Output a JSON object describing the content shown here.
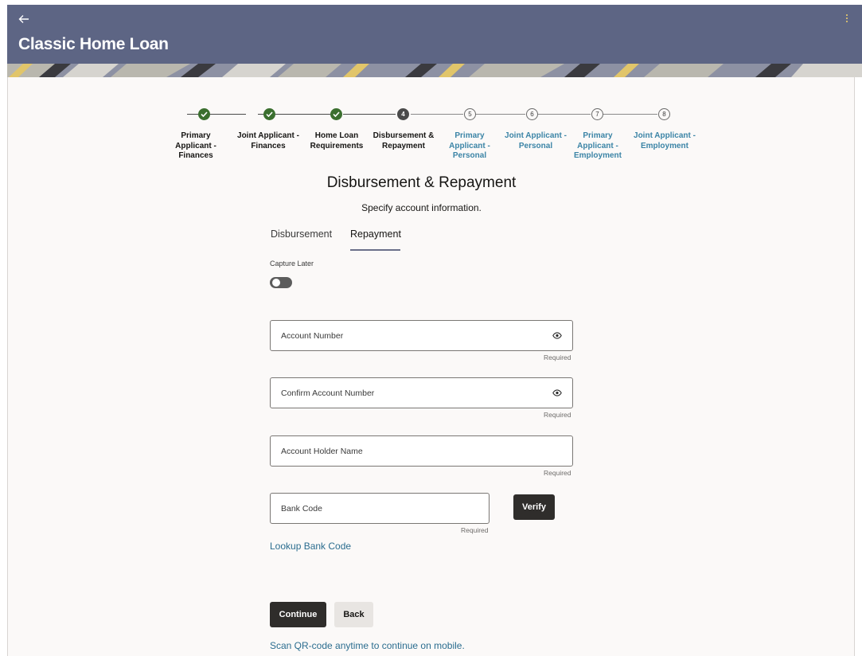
{
  "app": {
    "title": "Classic Home Loan"
  },
  "stepper": {
    "steps": [
      {
        "number": "1",
        "label": "Primary Applicant - Finances",
        "state": "done"
      },
      {
        "number": "2",
        "label": "Joint Applicant - Finances",
        "state": "done"
      },
      {
        "number": "3",
        "label": "Home Loan Requirements",
        "state": "done"
      },
      {
        "number": "4",
        "label": "Disbursement & Repayment",
        "state": "current"
      },
      {
        "number": "5",
        "label": "Primary Applicant - Personal",
        "state": "pending"
      },
      {
        "number": "6",
        "label": "Joint Applicant - Personal",
        "state": "pending"
      },
      {
        "number": "7",
        "label": "Primary Applicant - Employment",
        "state": "pending"
      },
      {
        "number": "8",
        "label": "Joint Applicant - Employment",
        "state": "pending"
      }
    ]
  },
  "page": {
    "title": "Disbursement & Repayment",
    "subtitle": "Specify account information."
  },
  "tabs": {
    "disbursement": "Disbursement",
    "repayment": "Repayment",
    "active": "Repayment"
  },
  "capture_later": {
    "label": "Capture Later",
    "on": false
  },
  "form": {
    "account_number": {
      "label": "Account Number",
      "value": "",
      "hint": "Required"
    },
    "confirm_account_number": {
      "label": "Confirm Account Number",
      "value": "",
      "hint": "Required"
    },
    "account_holder_name": {
      "label": "Account Holder Name",
      "value": "",
      "hint": "Required"
    },
    "bank_code": {
      "label": "Bank Code",
      "value": "",
      "hint": "Required"
    },
    "verify_label": "Verify",
    "lookup_label": "Lookup Bank Code"
  },
  "actions": {
    "continue_label": "Continue",
    "back_label": "Back",
    "qr_text": "Scan QR-code anytime to continue on mobile."
  },
  "colors": {
    "header": "#5d6584",
    "step_done": "#3b6f2f",
    "step_pending_text": "#3b84a6",
    "primary_button": "#2f2d2b",
    "link": "#2b6d8f"
  },
  "icons": {
    "back": "arrow-left-icon",
    "menu": "kebab-menu-icon",
    "done": "check-icon",
    "reveal": "eye-icon"
  }
}
